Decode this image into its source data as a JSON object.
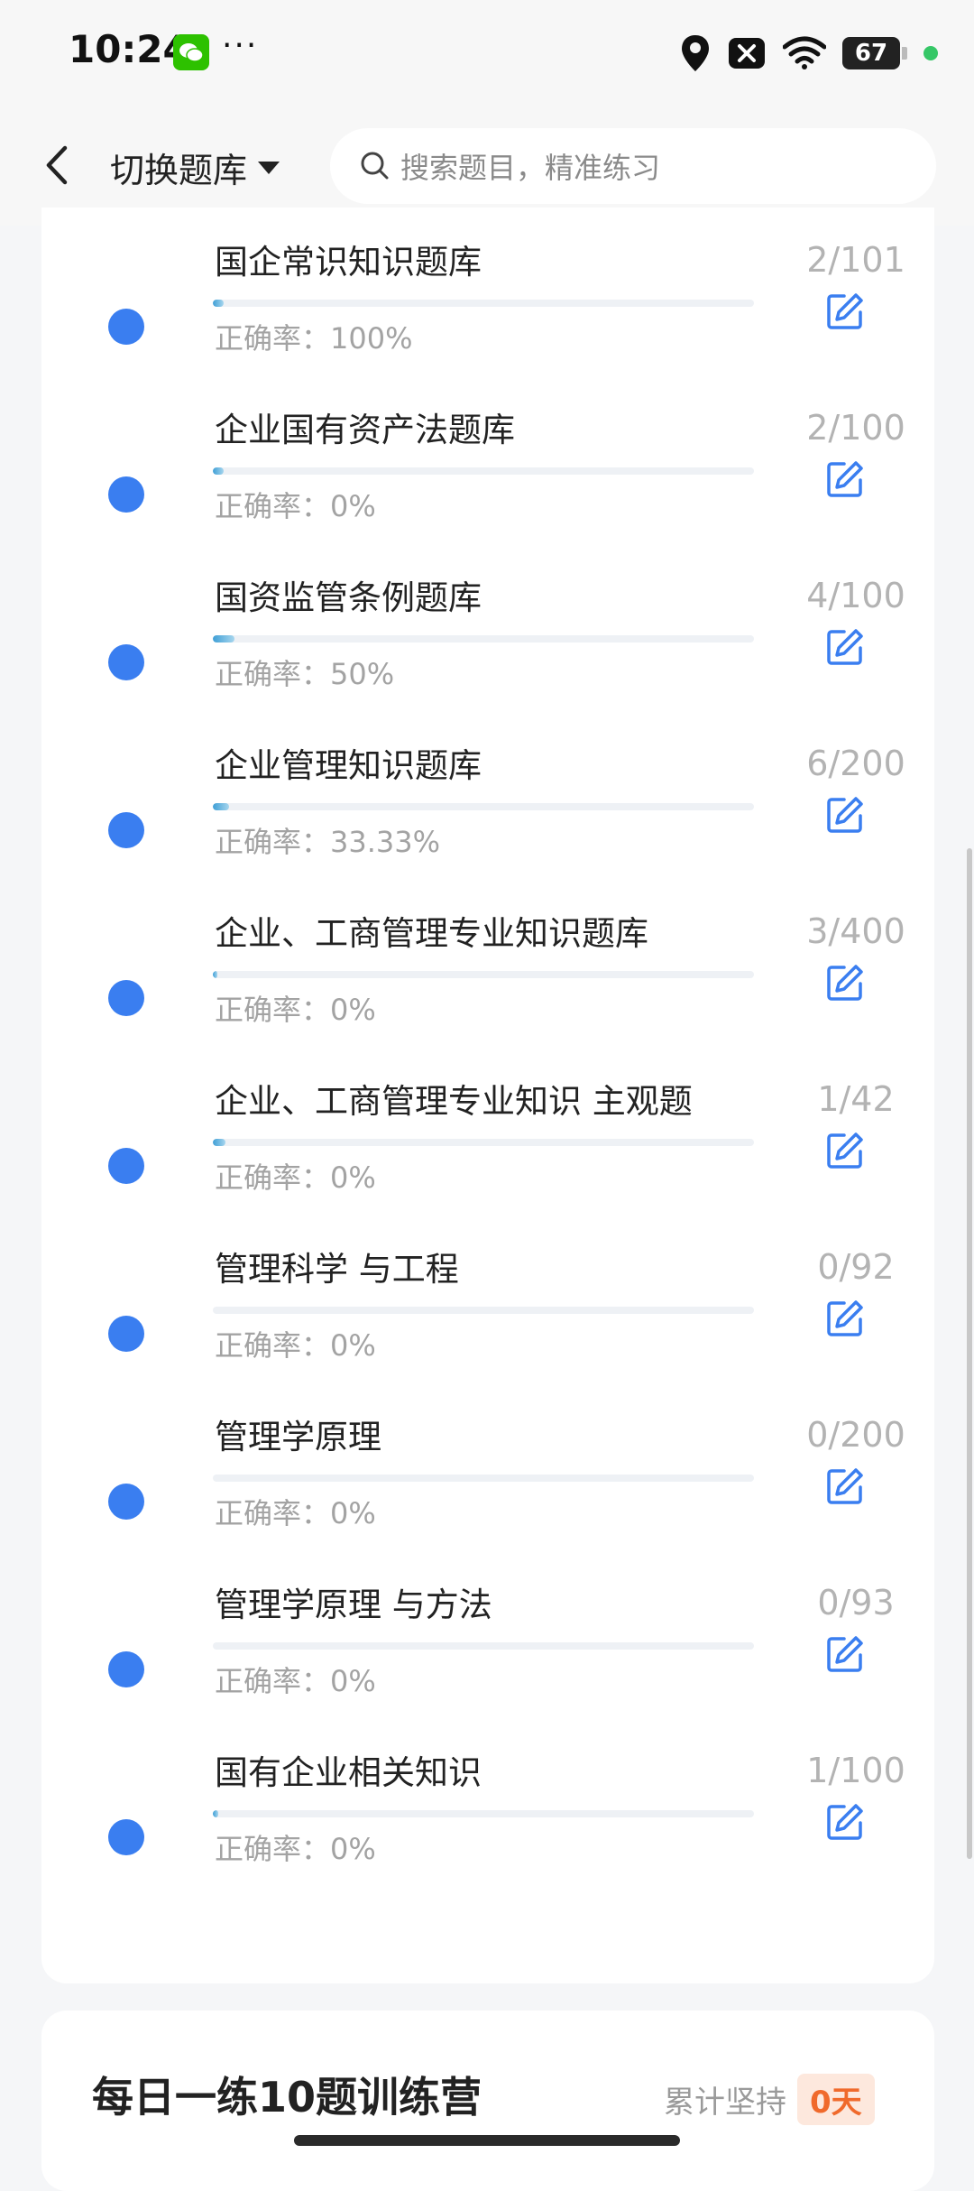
{
  "status_bar": {
    "time": "10:24",
    "more": "···",
    "battery": "67"
  },
  "header": {
    "title": "切换题库",
    "search_placeholder": "搜索题目，精准练习"
  },
  "accuracy_prefix": "正确率：",
  "banks": [
    {
      "title": "国企常识知识题库",
      "progress": 0.0198,
      "accuracy": "100%",
      "count": "2/101"
    },
    {
      "title": "企业国有资产法题库",
      "progress": 0.02,
      "accuracy": "0%",
      "count": "2/100"
    },
    {
      "title": "国资监管条例题库",
      "progress": 0.04,
      "accuracy": "50%",
      "count": "4/100"
    },
    {
      "title": "企业管理知识题库",
      "progress": 0.03,
      "accuracy": "33.33%",
      "count": "6/200"
    },
    {
      "title": "企业、工商管理专业知识题库",
      "progress": 0.0075,
      "accuracy": "0%",
      "count": "3/400"
    },
    {
      "title": "企业、工商管理专业知识 主观题",
      "progress": 0.0238,
      "accuracy": "0%",
      "count": "1/42"
    },
    {
      "title": "管理科学 与工程",
      "progress": 0,
      "accuracy": "0%",
      "count": "0/92"
    },
    {
      "title": "管理学原理",
      "progress": 0,
      "accuracy": "0%",
      "count": "0/200"
    },
    {
      "title": "管理学原理 与方法",
      "progress": 0,
      "accuracy": "0%",
      "count": "0/93"
    },
    {
      "title": "国有企业相关知识",
      "progress": 0.01,
      "accuracy": "0%",
      "count": "1/100"
    }
  ],
  "camp": {
    "title": "每日一练10题训练营",
    "label": "累计坚持",
    "days": "0天"
  },
  "colors": {
    "dot": "#3a7ef0",
    "edit_icon": "#3a7ef0",
    "badge_text": "#f06a2c"
  }
}
